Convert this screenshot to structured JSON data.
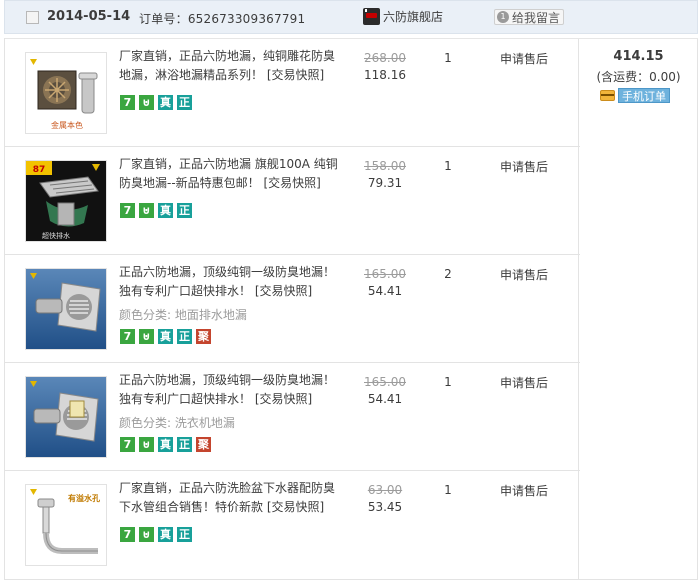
{
  "header": {
    "date": "2014-05-14",
    "order_label": "订单号：",
    "order_number": "652673309367791",
    "shop_name": "六防旗舰店",
    "message_count": "1",
    "message_label": "给我留言"
  },
  "summary": {
    "total": "414.15",
    "shipping": "(含运费：0.00)",
    "mobile_order_label": "手机订单"
  },
  "badge_labels": {
    "seven": "7",
    "guarantee": "",
    "real": "真",
    "genuine": "正",
    "red": "聚"
  },
  "items": [
    {
      "title": "厂家直销，正品六防地漏，纯铜雕花防臭地漏，淋浴地漏精品系列！",
      "snapshot": "[交易快照]",
      "spec": "",
      "original_price": "268.00",
      "price": "118.16",
      "quantity": "1",
      "aftersale": "申请售后",
      "thumb_text": "金属本色"
    },
    {
      "title": "厂家直销，正品六防地漏 旗舰100A 纯铜防臭地漏--新品特惠包邮！",
      "snapshot": "[交易快照]",
      "spec": "",
      "original_price": "158.00",
      "price": "79.31",
      "quantity": "1",
      "aftersale": "申请售后",
      "thumb_text": "超快排水",
      "thumb_tag": "87"
    },
    {
      "title": "正品六防地漏，顶级纯铜一级防臭地漏！独有专利广口超快排水！",
      "snapshot": "[交易快照]",
      "spec": "颜色分类: 地面排水地漏",
      "original_price": "165.00",
      "price": "54.41",
      "quantity": "2",
      "aftersale": "申请售后"
    },
    {
      "title": "正品六防地漏，顶级纯铜一级防臭地漏！独有专利广口超快排水！",
      "snapshot": "[交易快照]",
      "spec": "颜色分类: 洗衣机地漏",
      "original_price": "165.00",
      "price": "54.41",
      "quantity": "1",
      "aftersale": "申请售后"
    },
    {
      "title": "厂家直销，正品六防洗脸盆下水器配防臭下水管组合销售！特价新款",
      "snapshot": "[交易快照]",
      "spec": "",
      "original_price": "63.00",
      "price": "53.45",
      "quantity": "1",
      "aftersale": "申请售后",
      "thumb_text": "有溢水孔"
    }
  ],
  "colors": {
    "header_bg": "#eaf0f7",
    "badge_green": "#3aa640",
    "badge_teal": "#18a09a",
    "badge_red": "#c4452e",
    "mobile_blue": "#6eb2dd"
  }
}
